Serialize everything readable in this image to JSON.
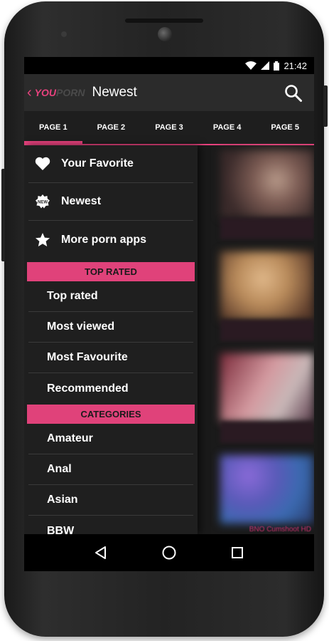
{
  "status": {
    "time": "21:42"
  },
  "appbar": {
    "back_symbol": "‹",
    "logo_you": "YOU",
    "logo_porn": "PORN",
    "title": "Newest",
    "search_icon": "search-icon"
  },
  "tabs": [
    {
      "label": "PAGE 1",
      "active": true
    },
    {
      "label": "PAGE 2",
      "active": false
    },
    {
      "label": "PAGE 3",
      "active": false
    },
    {
      "label": "PAGE 4",
      "active": false
    },
    {
      "label": "PAGE 5",
      "active": false
    }
  ],
  "drawer": {
    "main_items": [
      {
        "label": "Your Favorite",
        "icon": "heart-icon"
      },
      {
        "label": "Newest",
        "icon": "new-badge-icon"
      },
      {
        "label": "More porn apps",
        "icon": "star-icon"
      }
    ],
    "top_rated_header": "TOP RATED",
    "top_rated_items": [
      {
        "label": "Top rated"
      },
      {
        "label": "Most viewed"
      },
      {
        "label": "Most Favourite"
      },
      {
        "label": "Recommended"
      }
    ],
    "categories_header": "CATEGORIES",
    "category_items": [
      {
        "label": "Amateur"
      },
      {
        "label": "Anal"
      },
      {
        "label": "Asian"
      },
      {
        "label": "BBW"
      }
    ]
  },
  "thumbnails": {
    "caption": "BNO Cumshoot HD"
  },
  "colors": {
    "accent": "#e8427e",
    "section_header": "#e0427a",
    "background": "#1a1a1a"
  },
  "navbar": {
    "back": "back-triangle-icon",
    "home": "home-circle-icon",
    "recents": "recents-square-icon"
  }
}
